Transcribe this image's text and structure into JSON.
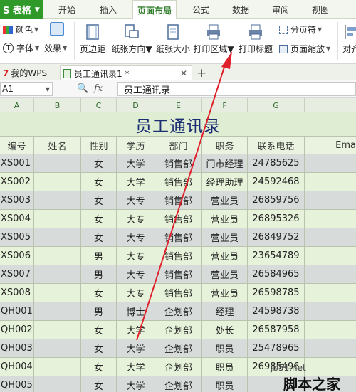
{
  "menubar": {
    "app_name": "S 表格",
    "tabs": [
      {
        "label": "开始"
      },
      {
        "label": "插入"
      },
      {
        "label": "页面布局"
      },
      {
        "label": "公式"
      },
      {
        "label": "数据"
      },
      {
        "label": "审阅"
      },
      {
        "label": "视图"
      }
    ]
  },
  "ribbon": {
    "color_label": "颜色",
    "font_label": "字体",
    "effect_label": "效果",
    "margin_label": "页边距",
    "orientation_label": "纸张方向",
    "size_label": "纸张大小",
    "print_area_label": "打印区域",
    "print_titles_label": "打印标题",
    "page_break_label": "分页符",
    "page_zoom_label": "页面缩放",
    "align_label": "对齐"
  },
  "doctabs": {
    "wps_label": "我的WPS",
    "file_label": "员工通讯录1 *",
    "add_label": "+"
  },
  "formula": {
    "cell_ref": "A1",
    "fx": "fx",
    "content": "员工通讯录"
  },
  "columns": [
    "A",
    "B",
    "C",
    "D",
    "E",
    "F",
    "G"
  ],
  "sheet": {
    "title": "员工通讯录",
    "headers": [
      "编号",
      "姓名",
      "性别",
      "学历",
      "部门",
      "职务",
      "联系电话",
      "Ema"
    ],
    "rows": [
      [
        "XS001",
        "",
        "女",
        "大学",
        "销售部",
        "门市经理",
        "24785625"
      ],
      [
        "XS002",
        "",
        "女",
        "大学",
        "销售部",
        "经理助理",
        "24592468"
      ],
      [
        "XS003",
        "",
        "女",
        "大专",
        "销售部",
        "营业员",
        "26859756"
      ],
      [
        "XS004",
        "",
        "女",
        "大专",
        "销售部",
        "营业员",
        "26895326"
      ],
      [
        "XS005",
        "",
        "女",
        "大专",
        "销售部",
        "营业员",
        "26849752"
      ],
      [
        "XS006",
        "",
        "男",
        "大专",
        "销售部",
        "营业员",
        "23654789"
      ],
      [
        "XS007",
        "",
        "男",
        "大专",
        "销售部",
        "营业员",
        "26584965"
      ],
      [
        "XS008",
        "",
        "女",
        "大专",
        "销售部",
        "营业员",
        "26598785"
      ],
      [
        "QH001",
        "",
        "男",
        "博士",
        "企划部",
        "经理",
        "24598738"
      ],
      [
        "QH002",
        "",
        "女",
        "大学",
        "企划部",
        "处长",
        "26587958"
      ],
      [
        "QH003",
        "",
        "女",
        "大学",
        "企划部",
        "职员",
        "25478965"
      ],
      [
        "QH004",
        "",
        "女",
        "大学",
        "企划部",
        "职员",
        "26985496"
      ],
      [
        "QH005",
        "",
        "女",
        "大学",
        "企划部",
        "职员",
        ""
      ]
    ]
  },
  "watermark": {
    "url": "jb51.net",
    "name": "脚本之家"
  },
  "colors": {
    "brand_green": "#2f9a2a",
    "title_blue": "#1c2e72",
    "arrow_red": "#e0202a"
  }
}
